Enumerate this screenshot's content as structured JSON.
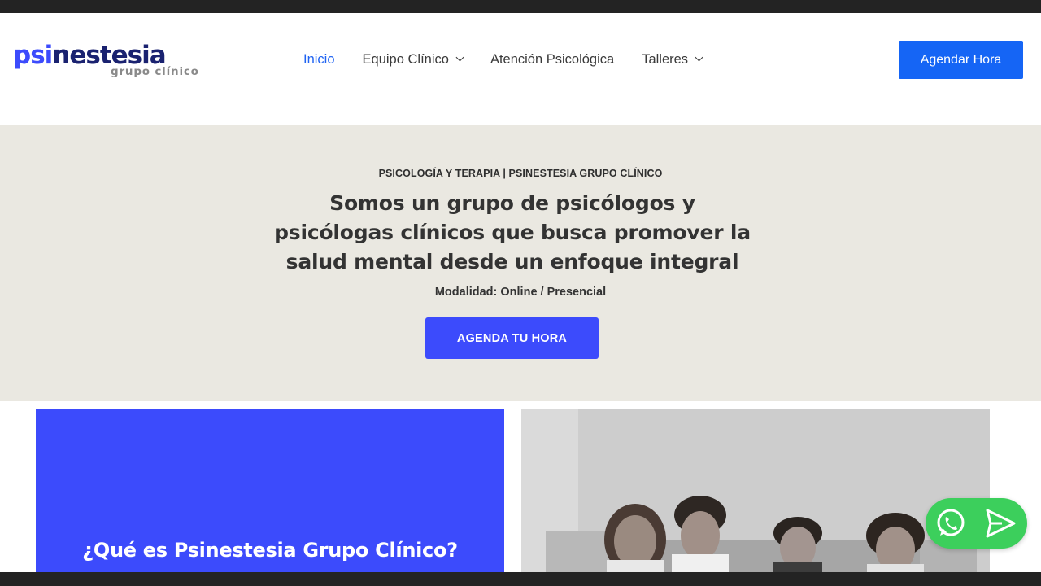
{
  "brand": {
    "logo_prefix": "psi",
    "logo_rest": "nestesia",
    "tagline": "grupo clínico",
    "primary_color": "#3c4bfc",
    "dark_color": "#1a2270",
    "nav_active_color": "#1f63f2",
    "cta_color": "#1565f5",
    "hero_bg": "#eae8e1",
    "whatsapp_color": "#3ccf5c"
  },
  "nav": {
    "items": [
      {
        "label": "Inicio",
        "active": true,
        "has_dropdown": false
      },
      {
        "label": "Equipo Clínico",
        "active": false,
        "has_dropdown": true,
        "icon": "chevron-down-icon"
      },
      {
        "label": "Atención Psicológica",
        "active": false,
        "has_dropdown": false
      },
      {
        "label": "Talleres",
        "active": false,
        "has_dropdown": true,
        "icon": "chevron-down-icon"
      }
    ],
    "cta_label": "Agendar Hora"
  },
  "hero": {
    "eyebrow": "PSICOLOGÍA Y TERAPIA | PSINESTESIA GRUPO CLÍNICO",
    "title": "Somos un grupo de psicólogos y psicólogas clínicos que busca promover la salud mental desde un enfoque integral",
    "subtitle": "Modalidad: Online / Presencial",
    "cta_label": "AGENDA TU HORA"
  },
  "about": {
    "heading": "¿Qué es Psinestesia Grupo Clínico?"
  },
  "floating_actions": {
    "icons": [
      "whatsapp-icon",
      "send-icon"
    ]
  }
}
